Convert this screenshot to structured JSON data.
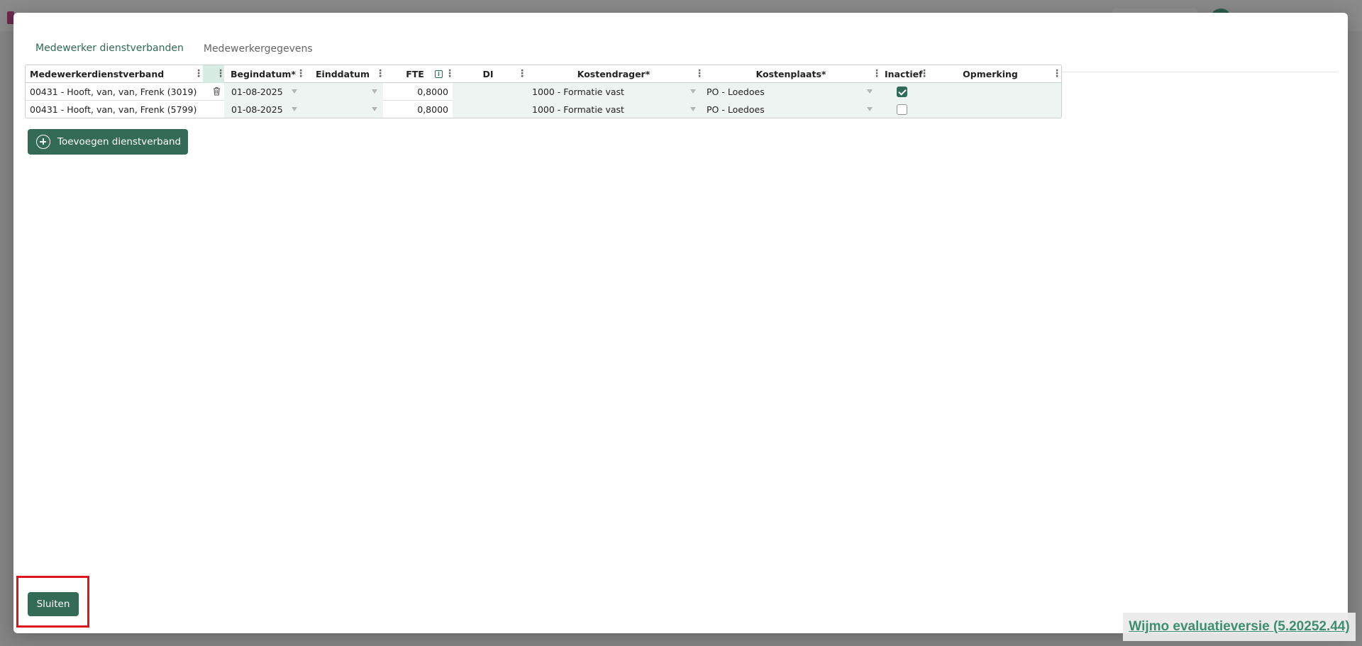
{
  "tabs": [
    {
      "label": "Medewerker dienstverbanden",
      "active": true
    },
    {
      "label": "Medewerkergegevens",
      "active": false
    }
  ],
  "grid": {
    "columns": [
      "Medewerkerdienstverband",
      "Begindatum*",
      "Einddatum",
      "FTE",
      "DI",
      "Kostendrager*",
      "Kostenplaats*",
      "Inactief",
      "Opmerking"
    ],
    "rows": [
      {
        "dienstverband": "00431 - Hooft, van, van, Frenk (3019)",
        "begindatum": "01-08-2025",
        "einddatum": "",
        "fte": "0,8000",
        "di": "",
        "kostendrager": "1000 - Formatie vast",
        "kostenplaats": "PO - Loedoes",
        "inactief": true,
        "opmerking": ""
      },
      {
        "dienstverband": "00431 - Hooft, van, van, Frenk (5799)",
        "begindatum": "01-08-2025",
        "einddatum": "",
        "fte": "0,8000",
        "di": "",
        "kostendrager": "1000 - Formatie vast",
        "kostenplaats": "PO - Loedoes",
        "inactief": false,
        "opmerking": ""
      }
    ]
  },
  "buttons": {
    "add": "Toevoegen dienstverband",
    "close": "Sluiten"
  },
  "watermark": "Wijmo evaluatieversie (5.20252.44)",
  "icons": {
    "kebab": "⋮",
    "info": "i"
  },
  "colors": {
    "accent": "#336b57",
    "highlight": "#e0141c"
  }
}
